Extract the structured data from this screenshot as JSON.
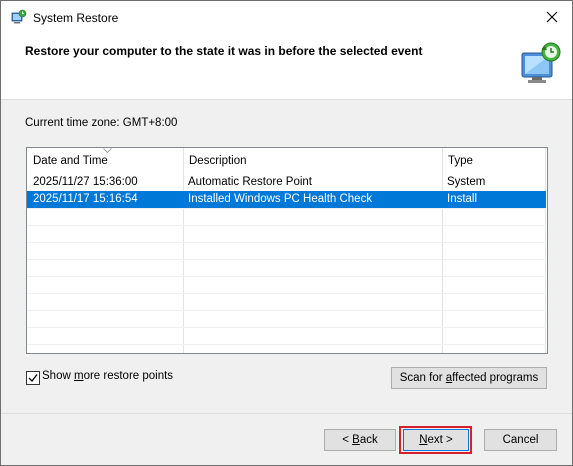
{
  "window": {
    "title": "System Restore"
  },
  "header": {
    "headline": "Restore your computer to the state it was in before the selected event"
  },
  "timezone": {
    "label": "Current time zone: GMT+8:00"
  },
  "table": {
    "columns": [
      "Date and Time",
      "Description",
      "Type"
    ],
    "rows": [
      {
        "datetime": "2025/11/27 15:36:00",
        "description": "Automatic Restore Point",
        "type": "System",
        "selected": false
      },
      {
        "datetime": "2025/11/17 15:16:54",
        "description": "Installed Windows PC Health Check",
        "type": "Install",
        "selected": true
      }
    ]
  },
  "options": {
    "show_more_pre": "Show ",
    "show_more_accel": "m",
    "show_more_post": "ore restore points",
    "show_more_checked": true
  },
  "buttons": {
    "scan_pre": "Scan for ",
    "scan_accel": "a",
    "scan_post": "ffected programs",
    "back_pre": "< ",
    "back_accel": "B",
    "back_post": "ack",
    "next_accel": "N",
    "next_post": "ext >",
    "cancel": "Cancel"
  },
  "colors": {
    "selection": "#0078d7",
    "highlight_box": "#d8202c"
  }
}
